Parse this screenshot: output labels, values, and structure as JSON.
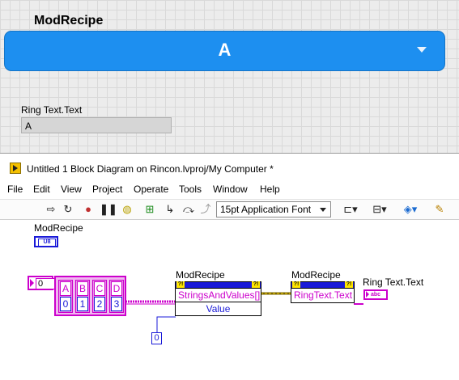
{
  "front_panel": {
    "ring_label": "ModRecipe",
    "ring_value": "A",
    "indicator_label": "Ring Text.Text",
    "indicator_value": "A"
  },
  "window": {
    "title": "Untitled 1 Block Diagram on Rincon.lvproj/My Computer *"
  },
  "menu": [
    "File",
    "Edit",
    "View",
    "Project",
    "Operate",
    "Tools",
    "Window",
    "Help"
  ],
  "toolbar": {
    "font": "15pt Application Font",
    "icons": [
      "run-arrow-icon",
      "run-continuous-icon",
      "abort-icon",
      "pause-icon",
      "highlight-bulb-icon",
      "retain-wire-icon",
      "step-into-icon",
      "step-over-icon",
      "step-out-icon",
      "align-icon",
      "distribute-icon",
      "reorder-icon",
      "cleanup-icon"
    ]
  },
  "diagram": {
    "ring_terminal_label": "ModRecipe",
    "ring_terminal_type": "U8",
    "array_index": "0",
    "array_strings": [
      "A",
      "B",
      "C",
      "D"
    ],
    "array_values": [
      "0",
      "1",
      "2",
      "3"
    ],
    "node1": {
      "label": "ModRecipe",
      "prop1": "StringsAndValues[]",
      "prop2": "Value"
    },
    "node2": {
      "label": "ModRecipe",
      "prop1": "RingText.Text"
    },
    "indicator_label": "Ring Text.Text",
    "indicator_type": "abc",
    "const_value": "0"
  }
}
